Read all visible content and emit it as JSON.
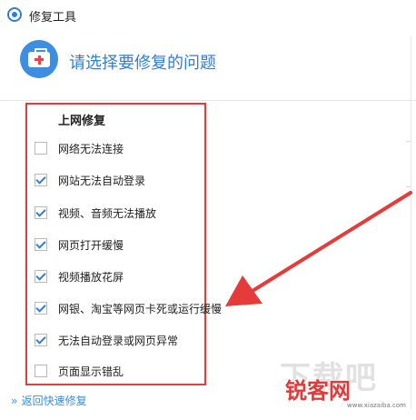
{
  "window": {
    "title": "修复工具"
  },
  "header": {
    "title": "请选择要修复的问题"
  },
  "section": {
    "title": "上网修复"
  },
  "items": [
    {
      "label": "网络无法连接",
      "checked": false
    },
    {
      "label": "网站无法自动登录",
      "checked": true
    },
    {
      "label": "视频、音频无法播放",
      "checked": true
    },
    {
      "label": "网页打开缓慢",
      "checked": true
    },
    {
      "label": "视频播放花屏",
      "checked": true
    },
    {
      "label": "网银、淘宝等网页卡死或运行缓慢",
      "checked": true
    },
    {
      "label": "无法自动登录或网页异常",
      "checked": true
    },
    {
      "label": "页面显示错乱",
      "checked": false
    }
  ],
  "footer": {
    "back_label": "返回快速修复"
  },
  "watermark": {
    "text": "锐客网",
    "ghost": "下载吧",
    "url": "www.xiazaiba.com"
  },
  "colors": {
    "accent": "#2f7fd6",
    "highlight": "#e53b3b"
  }
}
